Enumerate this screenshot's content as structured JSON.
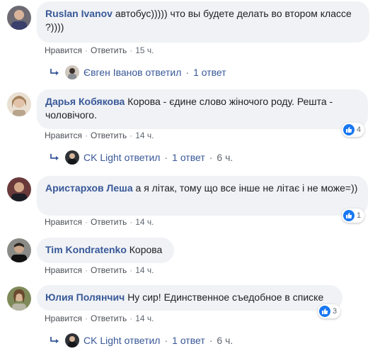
{
  "colors": {
    "author": "#385898",
    "bubble": "#f0f2f5",
    "like": "#1877f2",
    "meta": "#606770"
  },
  "comments": [
    {
      "author": "Ruslan Ivanov",
      "text": "автобус))))) что вы будете делать во втором классе ?))))",
      "like_label": "Нравится",
      "reply_label": "Ответить",
      "time": "15 ч.",
      "reaction_count": "",
      "replies": {
        "name": "Євген Іванов ответил",
        "count": "1 ответ",
        "time": "",
        "icon": "reply-arrow-icon"
      }
    },
    {
      "author": "Дарья Кобякова",
      "text": "Корова - єдине слово жіночого роду. Решта - чоловічого.",
      "like_label": "Нравится",
      "reply_label": "Ответить",
      "time": "14 ч.",
      "reaction_count": "4",
      "replies": {
        "name": "CK Light ответил",
        "count": "1 ответ",
        "time": "6 ч.",
        "icon": "reply-arrow-icon"
      }
    },
    {
      "author": "Аристархов Леша",
      "text": "а я літак, тому що все інше не літає і не може=))",
      "like_label": "Нравится",
      "reply_label": "Ответить",
      "time": "14 ч.",
      "reaction_count": "1",
      "replies": null
    },
    {
      "author": "Tim Kondratenko",
      "text": "Корова",
      "like_label": "Нравится",
      "reply_label": "Ответить",
      "time": "14 ч.",
      "reaction_count": "",
      "replies": null
    },
    {
      "author": "Юлия Полянчич",
      "text": "Ну сир! Единственное съедобное в списке",
      "like_label": "Нравится",
      "reply_label": "Ответить",
      "time": "14 ч.",
      "reaction_count": "3",
      "replies": {
        "name": "CK Light ответил",
        "count": "1 ответ",
        "time": "6 ч.",
        "icon": "reply-arrow-icon"
      }
    }
  ]
}
